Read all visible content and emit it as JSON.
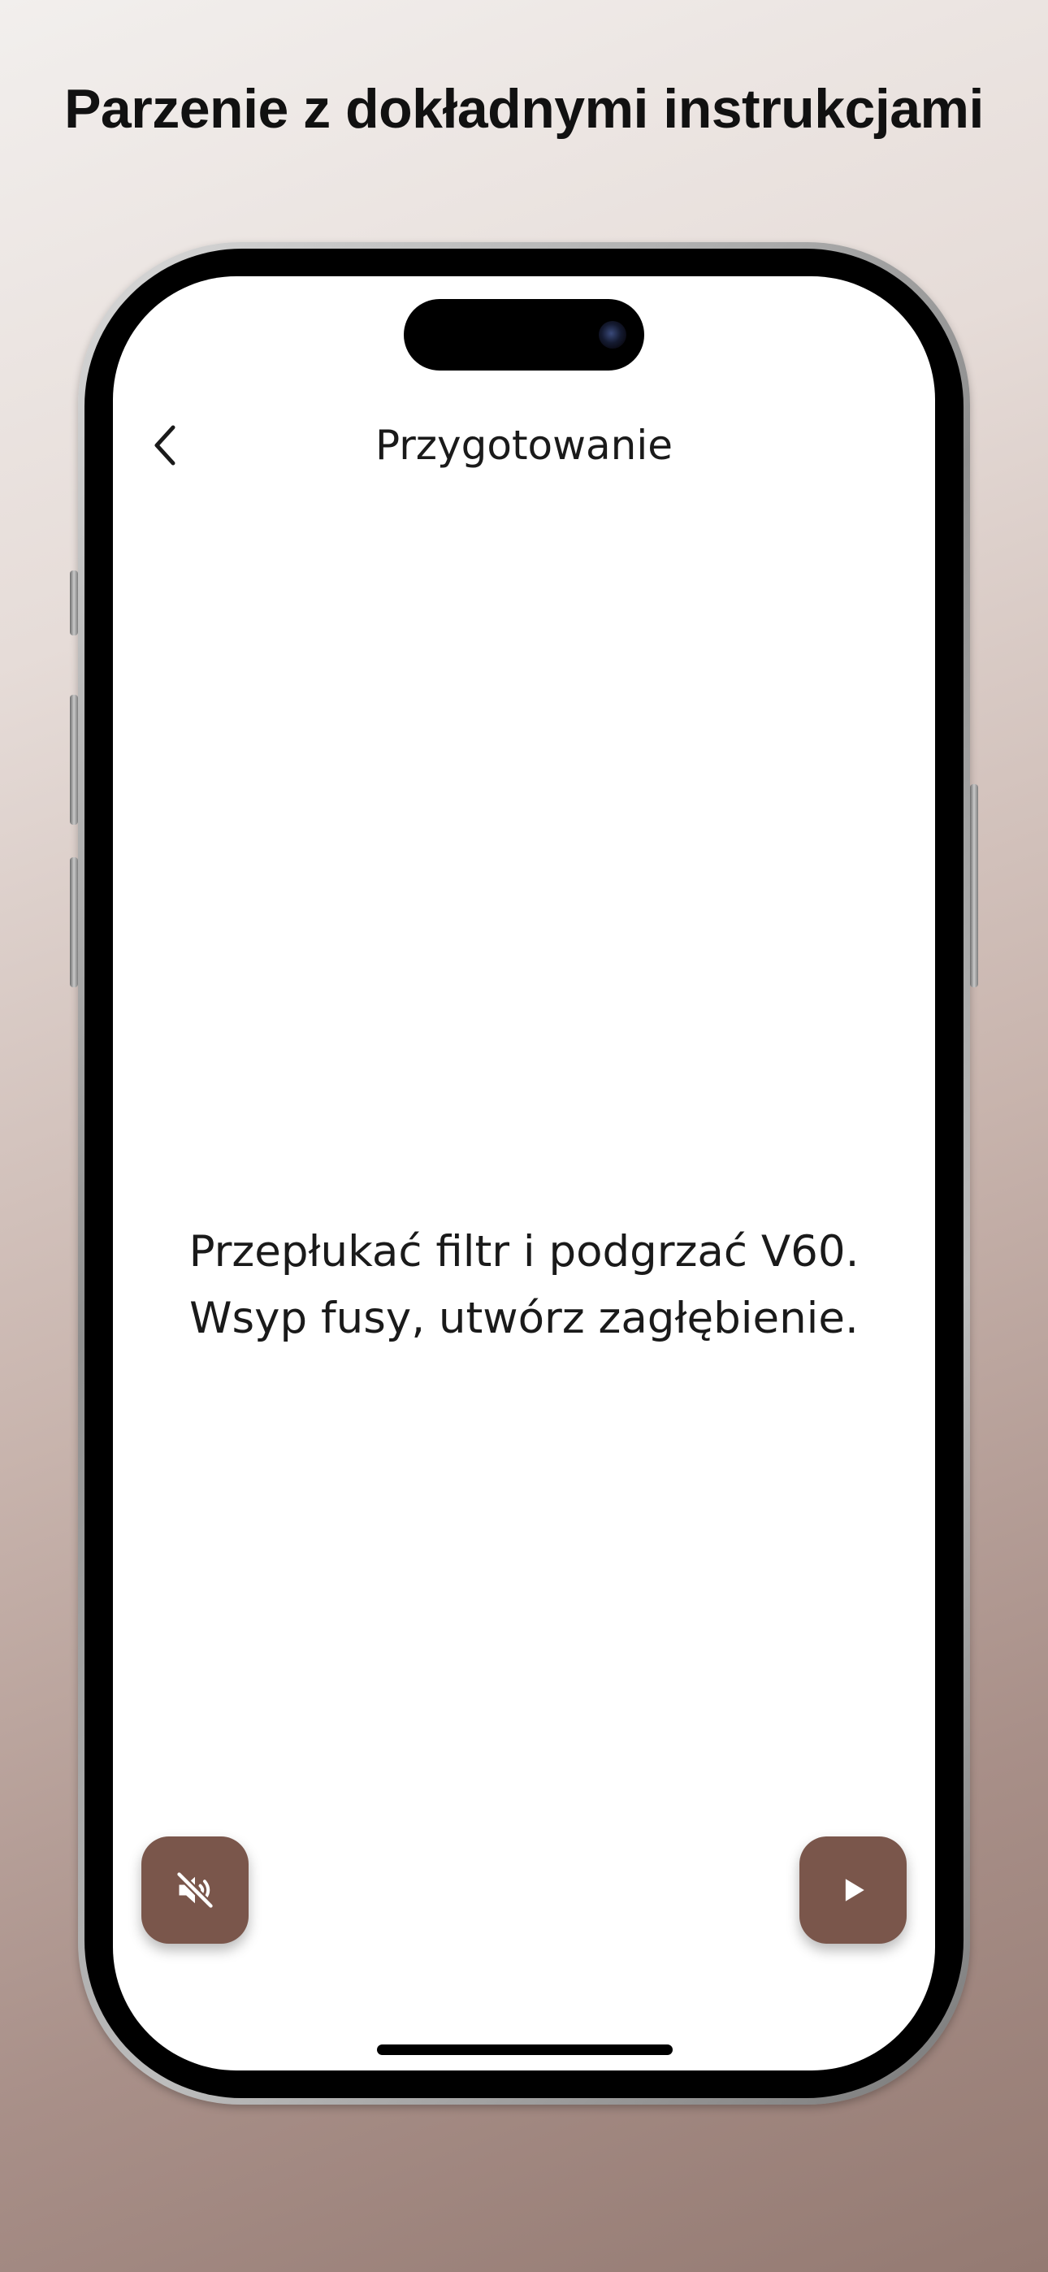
{
  "marketing": {
    "headline": "Parzenie z dokładnymi instrukcjami"
  },
  "screen": {
    "title": "Przygotowanie",
    "back_icon": "chevron-left-icon",
    "instruction_lines": [
      "Przepłukać filtr i podgrzać V60.",
      "Wsyp fusy, utwórz zagłębienie."
    ],
    "buttons": {
      "mute_icon": "speaker-muted-icon",
      "play_icon": "play-icon"
    }
  },
  "colors": {
    "accent": "#7a564b",
    "text": "#1a1a1a",
    "background": "#ffffff"
  }
}
